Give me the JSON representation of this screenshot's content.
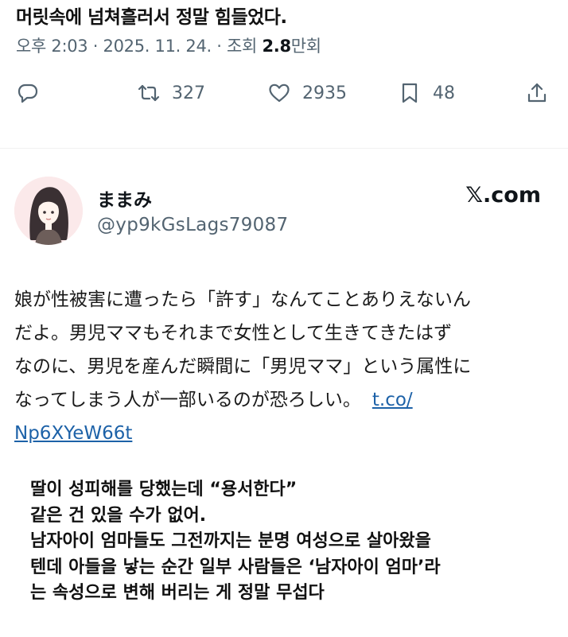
{
  "top_line": "머릿속에 넘쳐흘러서 정말 힘들었다.",
  "meta": {
    "time": "오후 2:03",
    "sep1": " · ",
    "date": "2025. 11. 24.",
    "sep2": " · ",
    "views_label": "조회 ",
    "views_value": "2.8",
    "views_unit": "만회"
  },
  "actions": {
    "retweets": "327",
    "likes": "2935",
    "bookmarks": "48"
  },
  "quoted": {
    "name": "ままみ",
    "handle": "@yp9kGsLags79087",
    "source": "𝕏.com",
    "text_lines": [
      "娘が性被害に遭ったら「許す」なんてことありえないん",
      "だよ。男児ママもそれまで女性として生きてきたはず",
      "なのに、男児を産んだ瞬間に「男児ママ」という属性に",
      "なってしまう人が一部いるのが恐ろしい。"
    ],
    "link_part1": "t.co/",
    "link_part2": "Np6XYeW66t"
  },
  "translation_lines": [
    "딸이 성피해를 당했는데 “용서한다”",
    "같은 건 있을 수가 없어.",
    "남자아이 엄마들도 그전까지는 분명 여성으로 살아왔을",
    "텐데 아들을 낳는 순간 일부 사람들은 ‘남자아이 엄마’라",
    "는 속성으로 변해 버리는 게 정말 무섭다"
  ]
}
